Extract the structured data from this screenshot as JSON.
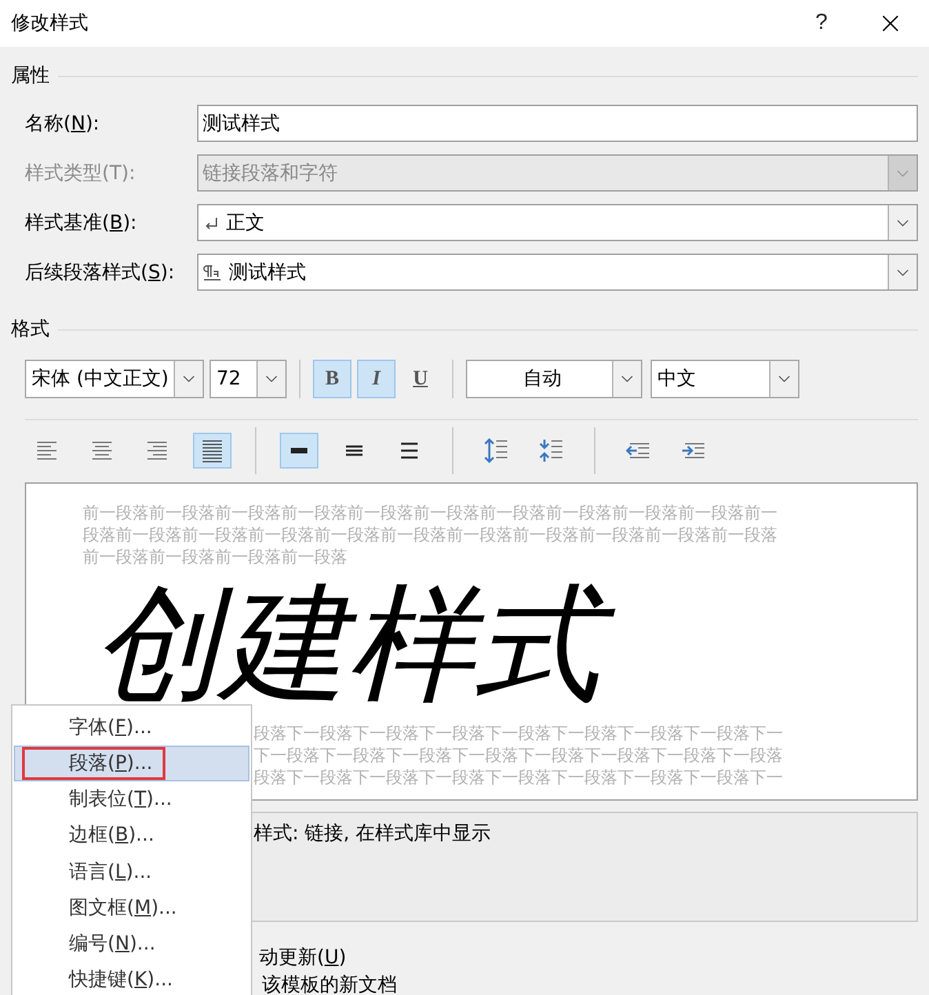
{
  "window": {
    "title": "修改样式",
    "help": "?"
  },
  "properties": {
    "heading": "属性",
    "fields": [
      {
        "label": [
          "名称(",
          "N",
          "):"
        ],
        "kind": "text",
        "value": "测试样式",
        "disabled": false
      },
      {
        "label": [
          "样式类型(T):"
        ],
        "kind": "select",
        "value": "链接段落和字符",
        "disabled": true
      },
      {
        "label": [
          "样式基准(",
          "B",
          "):"
        ],
        "kind": "select",
        "value": {
          "kind": "paragraph",
          "text": "正文"
        },
        "disabled": false
      },
      {
        "label": [
          "后续段落样式(",
          "S",
          "):"
        ],
        "kind": "select",
        "value": {
          "kind": "linked",
          "text": "测试样式"
        },
        "disabled": false
      }
    ]
  },
  "format": {
    "heading": "格式",
    "font": "宋体 (中文正文)",
    "size": "72",
    "toggles": [
      {
        "kind": "bold",
        "text": "B",
        "on": true
      },
      {
        "kind": "italic",
        "text": "I",
        "on": true
      },
      {
        "kind": "underline",
        "text": "U",
        "on": false
      }
    ],
    "font_color_setting": "自动",
    "language": "中文",
    "paragraph_button_groups": [
      [
        {
          "kind": "align-left",
          "selected": false
        },
        {
          "kind": "align-center",
          "selected": false
        },
        {
          "kind": "align-right",
          "selected": false
        },
        {
          "kind": "justify",
          "selected": true
        }
      ],
      [
        {
          "kind": "single",
          "selected": true
        },
        {
          "kind": "one-half",
          "selected": false
        },
        {
          "kind": "double",
          "selected": false
        }
      ],
      [
        {
          "kind": "space-up",
          "selected": false
        },
        {
          "kind": "space-down",
          "selected": false
        }
      ],
      [
        {
          "kind": "outdent",
          "selected": false
        },
        {
          "kind": "indent",
          "selected": false
        }
      ]
    ]
  },
  "preview": {
    "before_lines": [
      "前一段落前一段落前一段落前一段落前一段落前一段落前一段落前一段落前一段落前一段落前一",
      "段落前一段落前一段落前一段落前一段落前一段落前一段落前一段落前一段落前一段落前一段落",
      "前一段落前一段落前一段落前一段落"
    ],
    "sample": "创建样式",
    "after_lines": [
      "段落下一段落下一段落下一段落下一段落下一段落下一段落下一段落下一",
      "下一段落下一段落下一段落下一段落下一段落下一段落下一段落下一段落",
      "段落下一段落下一段落下一段落下一段落下一段落下一段落下一段落下一"
    ]
  },
  "description": "样式: 链接, 在样式库中显示",
  "auto_update": [
    "动更新(",
    "U",
    ")"
  ],
  "new_documents": "该模板的新文档",
  "context_menu": [
    {
      "label": [
        "字体(",
        "F",
        ")..."
      ],
      "selected": false,
      "annotated": false
    },
    {
      "label": [
        "段落(",
        "P",
        ")..."
      ],
      "selected": true,
      "annotated": true
    },
    {
      "label": [
        "制表位(",
        "T",
        ")..."
      ],
      "selected": false,
      "annotated": false
    },
    {
      "label": [
        "边框(",
        "B",
        ")..."
      ],
      "selected": false,
      "annotated": false
    },
    {
      "label": [
        "语言(",
        "L",
        ")..."
      ],
      "selected": false,
      "annotated": false
    },
    {
      "label": [
        "图文框(",
        "M",
        ")..."
      ],
      "selected": false,
      "annotated": false
    },
    {
      "label": [
        "编号(",
        "N",
        ")..."
      ],
      "selected": false,
      "annotated": false
    },
    {
      "label": [
        "快捷键(",
        "K",
        ")..."
      ],
      "selected": false,
      "annotated": false
    }
  ]
}
